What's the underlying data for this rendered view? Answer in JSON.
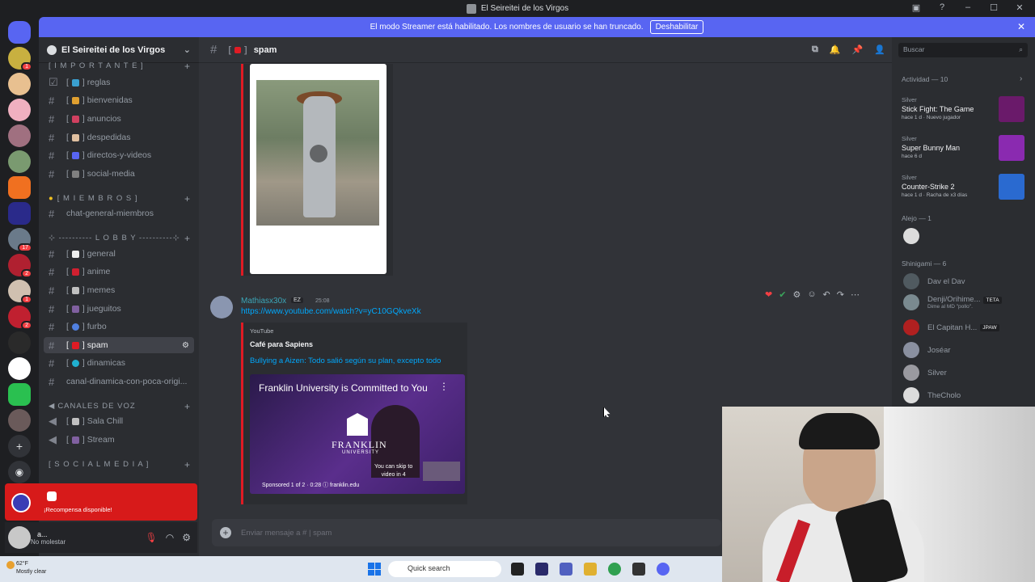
{
  "window": {
    "title": "El Seireitei de los Virgos"
  },
  "streamer_bar": {
    "text": "El modo Streamer está habilitado. Los nombres de usuario se han truncado.",
    "button": "Deshabilitar"
  },
  "guild": {
    "name": "El Seireitei de los Virgos"
  },
  "categories": [
    {
      "label": "[ I M P O R T A N T E ]"
    },
    {
      "label": "[ M I E M B R O S ]"
    },
    {
      "label": "⊹ ---------- L O B B Y ----------⊹"
    },
    {
      "label": "CANALES DE VOZ"
    },
    {
      "label": "[ S O C I A L M E D I A ]"
    }
  ],
  "channels": [
    {
      "name": "reglas"
    },
    {
      "name": "bienvenidas"
    },
    {
      "name": "anuncios"
    },
    {
      "name": "despedidas"
    },
    {
      "name": "directos-y-videos"
    },
    {
      "name": "social-media"
    },
    {
      "name": "chat-general-miembros"
    },
    {
      "name": "general"
    },
    {
      "name": "anime"
    },
    {
      "name": "memes"
    },
    {
      "name": "jueguitos"
    },
    {
      "name": "furbo"
    },
    {
      "name": "spam"
    },
    {
      "name": "dinamicas"
    },
    {
      "name": "canal-dinamica-con-poca-origi..."
    },
    {
      "name": "Sala Chill"
    },
    {
      "name": "Stream"
    }
  ],
  "reward": {
    "text": "¡Recompensa disponible!"
  },
  "user": {
    "name": "a...",
    "status": "No molestar"
  },
  "channel_header": {
    "name": "spam"
  },
  "message": {
    "author": "Mathiasx30x",
    "tag": "EZ",
    "time": "25:08",
    "link": "https://www.youtube.com/watch?v=yC10GQkveXk",
    "embed": {
      "provider": "YouTube",
      "author": "Café para Sapiens",
      "title": "Bullying a Aizen: Todo salió según su plan, excepto todo",
      "video_title": "Franklin University is Committed to You",
      "brand": "FRANKLIN",
      "brand_sub": "UNIVERSITY",
      "skip_text_1": "You can skip to",
      "skip_text_2": "video in 4",
      "sponsored": "Sponsored 1 of 2 · 0:28 ⓘ franklin.edu"
    }
  },
  "composer": {
    "placeholder": "Enviar mensaje a # | spam"
  },
  "search": {
    "placeholder": "Buscar"
  },
  "activity": {
    "header": "Actividad — 10",
    "items": [
      {
        "who": "Silver",
        "game": "Stick Fight: The Game",
        "sub": "hace 1 d · Nuevo jugador",
        "color": "#6a1a6a"
      },
      {
        "who": "Silver",
        "game": "Super Bunny Man",
        "sub": "hace 6 d",
        "color": "#8a2ab0"
      },
      {
        "who": "Silver",
        "game": "Counter-Strike 2",
        "sub": "hace 1 d · Racha de x3 días",
        "color": "#2a6ad0"
      }
    ]
  },
  "groups": [
    {
      "label": "Alejo — 1"
    },
    {
      "label": "Shinigami — 6"
    }
  ],
  "members": [
    {
      "name": "Dav el Dav",
      "tag": ""
    },
    {
      "name": "Denji/Orihime...",
      "tag": "TETA",
      "sub": "Dime al MD \"pollo\"."
    },
    {
      "name": "El Capitan H...",
      "tag": "JPAW"
    },
    {
      "name": "Joséar",
      "tag": ""
    },
    {
      "name": "Silver",
      "tag": ""
    },
    {
      "name": "TheCholo",
      "tag": ""
    }
  ],
  "taskbar": {
    "temp": "62°F",
    "weather": "Mostly clear",
    "search": "Quick search"
  },
  "colors": {
    "accent": "#5865f2",
    "embed_bar": "#e01b24",
    "link": "#00a8fc"
  }
}
